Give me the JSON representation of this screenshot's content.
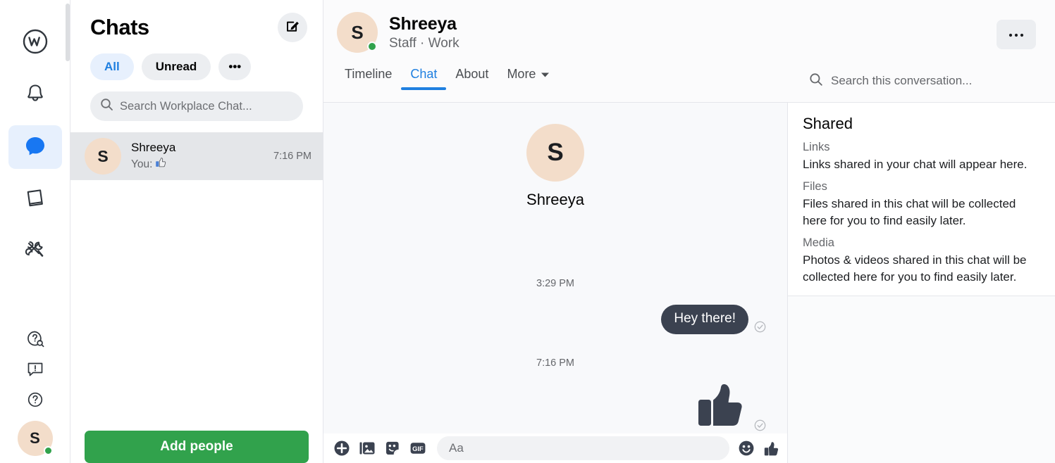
{
  "rail": {
    "items": [
      {
        "name": "workplace-logo",
        "label": "Workplace"
      },
      {
        "name": "notifications",
        "label": "Notifications"
      },
      {
        "name": "chat",
        "label": "Chat"
      },
      {
        "name": "knowledge-library",
        "label": "Knowledge Library"
      },
      {
        "name": "tools",
        "label": "Tools"
      }
    ],
    "bottom_items": [
      {
        "name": "help-search",
        "label": "Search help"
      },
      {
        "name": "feedback",
        "label": "Give feedback"
      },
      {
        "name": "help",
        "label": "Help"
      }
    ],
    "avatar_initial": "S",
    "status": "online"
  },
  "chatlist": {
    "title": "Chats",
    "compose_label": "New message",
    "filters": [
      {
        "label": "All",
        "selected": true
      },
      {
        "label": "Unread",
        "selected": false
      },
      {
        "label": "•••",
        "selected": false
      }
    ],
    "search_placeholder": "Search Workplace Chat...",
    "rows": [
      {
        "avatar_initial": "S",
        "name": "Shreeya",
        "snippet_prefix": "You:",
        "snippet_icon": "thumbs-up-blue",
        "time": "7:16 PM",
        "active": true
      }
    ],
    "add_people_label": "Add people"
  },
  "conversation": {
    "avatar_initial": "S",
    "name": "Shreeya",
    "subtitle": "Staff · Work",
    "status": "online",
    "tabs": [
      {
        "label": "Timeline",
        "selected": false,
        "caret": false
      },
      {
        "label": "Chat",
        "selected": true,
        "caret": false
      },
      {
        "label": "About",
        "selected": false,
        "caret": false
      },
      {
        "label": "More",
        "selected": false,
        "caret": true
      }
    ],
    "more_button_label": "•••",
    "search_placeholder": "Search this conversation...",
    "intro": {
      "avatar_initial": "S",
      "name": "Shreeya"
    },
    "messages": [
      {
        "type": "timestamp",
        "text": "3:29 PM"
      },
      {
        "type": "text",
        "direction": "outgoing",
        "text": "Hey there!",
        "delivered": true
      },
      {
        "type": "timestamp",
        "text": "7:16 PM"
      },
      {
        "type": "sticker",
        "direction": "outgoing",
        "sticker": "thumbs-up",
        "delivered": true
      }
    ]
  },
  "composer": {
    "icons": [
      {
        "name": "add-attachment-icon",
        "glyph": "plus"
      },
      {
        "name": "photo-icon",
        "glyph": "photo"
      },
      {
        "name": "sticker-icon",
        "glyph": "sticker"
      },
      {
        "name": "gif-icon",
        "glyph": "GIF"
      }
    ],
    "input_placeholder": "Aa",
    "right_icons": [
      {
        "name": "emoji-icon",
        "glyph": "smiley"
      },
      {
        "name": "like-icon",
        "glyph": "thumbs-up"
      }
    ]
  },
  "shared": {
    "title": "Shared",
    "sections": [
      {
        "label": "Links",
        "text": "Links shared in your chat will appear here."
      },
      {
        "label": "Files",
        "text": "Files shared in this chat will be collected here for you to find easily later."
      },
      {
        "label": "Media",
        "text": "Photos & videos shared in this chat will be collected here for you to find easily later."
      }
    ]
  },
  "colors": {
    "accent_blue": "#1f7fe0",
    "accent_blue_soft": "#e7f0fd",
    "green": "#31a24c",
    "bubble_dark": "#3b4250",
    "avatar_bg": "#f3ddca",
    "panel_bg": "#f8f9fb",
    "grey_pill": "#eceef1"
  }
}
